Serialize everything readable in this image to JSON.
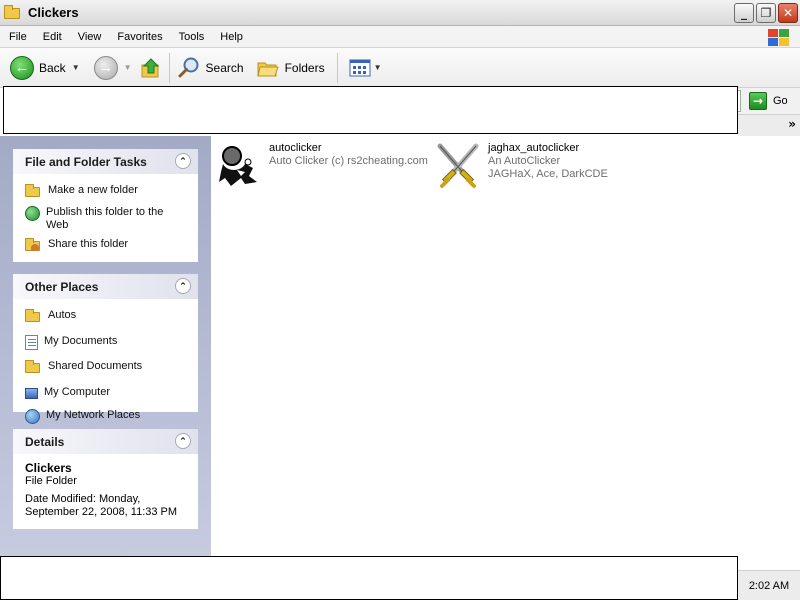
{
  "window": {
    "title": "Clickers",
    "buttons": {
      "minimize": "_",
      "maximize": "❐",
      "close": "✕"
    }
  },
  "menu": [
    "File",
    "Edit",
    "View",
    "Favorites",
    "Tools",
    "Help"
  ],
  "toolbar": {
    "back_label": "Back",
    "search_label": "Search",
    "folders_label": "Folders"
  },
  "address": {
    "go_label": "Go"
  },
  "sidebar": {
    "file_tasks": {
      "title": "File and Folder Tasks",
      "items": [
        {
          "label": "Make a new folder",
          "icon": "new-folder-icon"
        },
        {
          "label": "Publish this folder to the Web",
          "icon": "publish-web-icon"
        },
        {
          "label": "Share this folder",
          "icon": "share-folder-icon"
        }
      ]
    },
    "other_places": {
      "title": "Other Places",
      "items": [
        {
          "label": "Autos",
          "icon": "folder-icon"
        },
        {
          "label": "My Documents",
          "icon": "my-documents-icon"
        },
        {
          "label": "Shared Documents",
          "icon": "folder-icon"
        },
        {
          "label": "My Computer",
          "icon": "my-computer-icon"
        },
        {
          "label": "My Network Places",
          "icon": "network-places-icon"
        }
      ]
    },
    "details": {
      "title": "Details",
      "name": "Clickers",
      "type": "File Folder",
      "modified_line1": "Date Modified: Monday,",
      "modified_line2": "September 22, 2008, 11:33 PM"
    }
  },
  "files": [
    {
      "name": "autoclicker",
      "desc1": "Auto Clicker (c) rs2cheating.com",
      "desc2": "",
      "icon": "autoclicker-app-icon"
    },
    {
      "name": "jaghax_autoclicker",
      "desc1": "An AutoClicker",
      "desc2": "JAGHaX, Ace, DarkCDE",
      "icon": "crossed-swords-icon"
    }
  ],
  "clock": "2:02 AM"
}
